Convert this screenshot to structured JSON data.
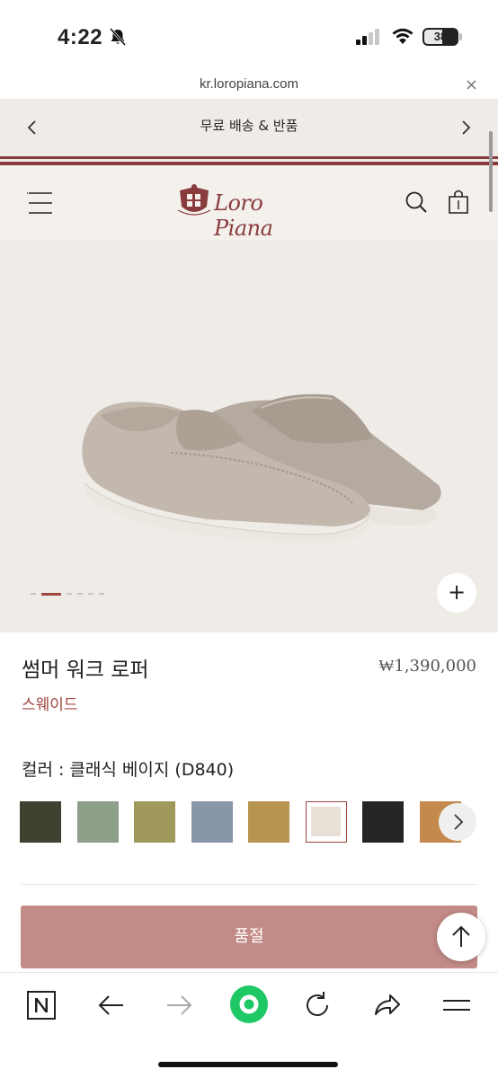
{
  "status_bar": {
    "time": "4:22",
    "battery": "38"
  },
  "browser": {
    "url": "kr.loropiana.com",
    "close_label": "×"
  },
  "promo": {
    "text": "무료 배송 & 반품"
  },
  "header": {
    "logo_text": "Loro Piana"
  },
  "product": {
    "name": "썸머 워크 로퍼",
    "price": "₩1,390,000",
    "material": "스웨이드",
    "color_label": "컬러 : 클래식 베이지 (D840)",
    "zoom_label": "+",
    "sold_out_label": "품절"
  },
  "swatches": [
    {
      "name": "dark-olive",
      "color": "#3d4231"
    },
    {
      "name": "sage-green",
      "color": "#8ea08a"
    },
    {
      "name": "olive",
      "color": "#9f9a5b"
    },
    {
      "name": "slate-blue",
      "color": "#8796a8"
    },
    {
      "name": "tan",
      "color": "#b79551"
    },
    {
      "name": "classic-beige",
      "color": "#e9e0d7",
      "selected": true
    },
    {
      "name": "black",
      "color": "#252525"
    },
    {
      "name": "cognac",
      "color": "#c48a4d"
    }
  ],
  "colors": {
    "brand": "#8a3b3d",
    "accent": "#a0453f",
    "sold_out": "#c28b87"
  }
}
